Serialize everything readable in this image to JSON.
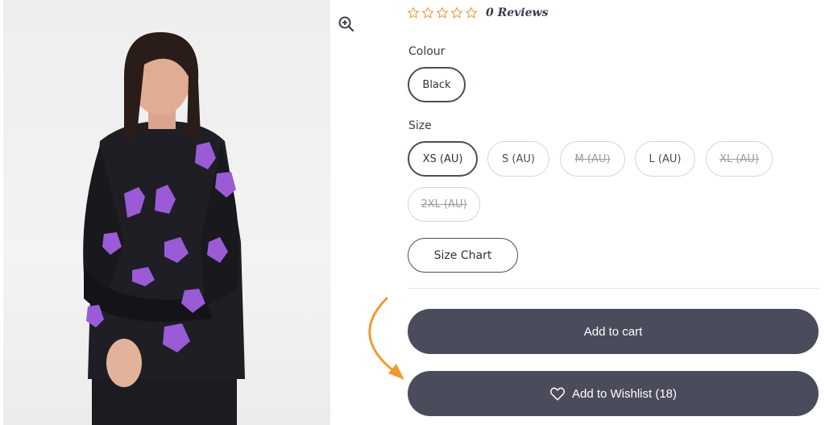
{
  "product": {
    "image_alt": "Model wearing black fluffy cardigan with purple cat pattern"
  },
  "rating": {
    "stars": 0,
    "max_stars": 5,
    "star_color": "#e69a3c",
    "reviews_label": "0 Reviews"
  },
  "colour": {
    "label": "Colour",
    "options": [
      {
        "label": "Black",
        "selected": true
      }
    ]
  },
  "size": {
    "label": "Size",
    "options": [
      {
        "label": "XS (AU)",
        "selected": true,
        "available": true
      },
      {
        "label": "S (AU)",
        "selected": false,
        "available": true
      },
      {
        "label": "M (AU)",
        "selected": false,
        "available": false
      },
      {
        "label": "L (AU)",
        "selected": false,
        "available": true
      },
      {
        "label": "XL (AU)",
        "selected": false,
        "available": false
      },
      {
        "label": "2XL (AU)",
        "selected": false,
        "available": false
      }
    ]
  },
  "size_chart_label": "Size Chart",
  "add_to_cart_label": "Add to cart",
  "add_to_wishlist_label": "Add to Wishlist (18)",
  "colors": {
    "button_bg": "#4a4c5c",
    "arrow": "#f29a2e"
  }
}
